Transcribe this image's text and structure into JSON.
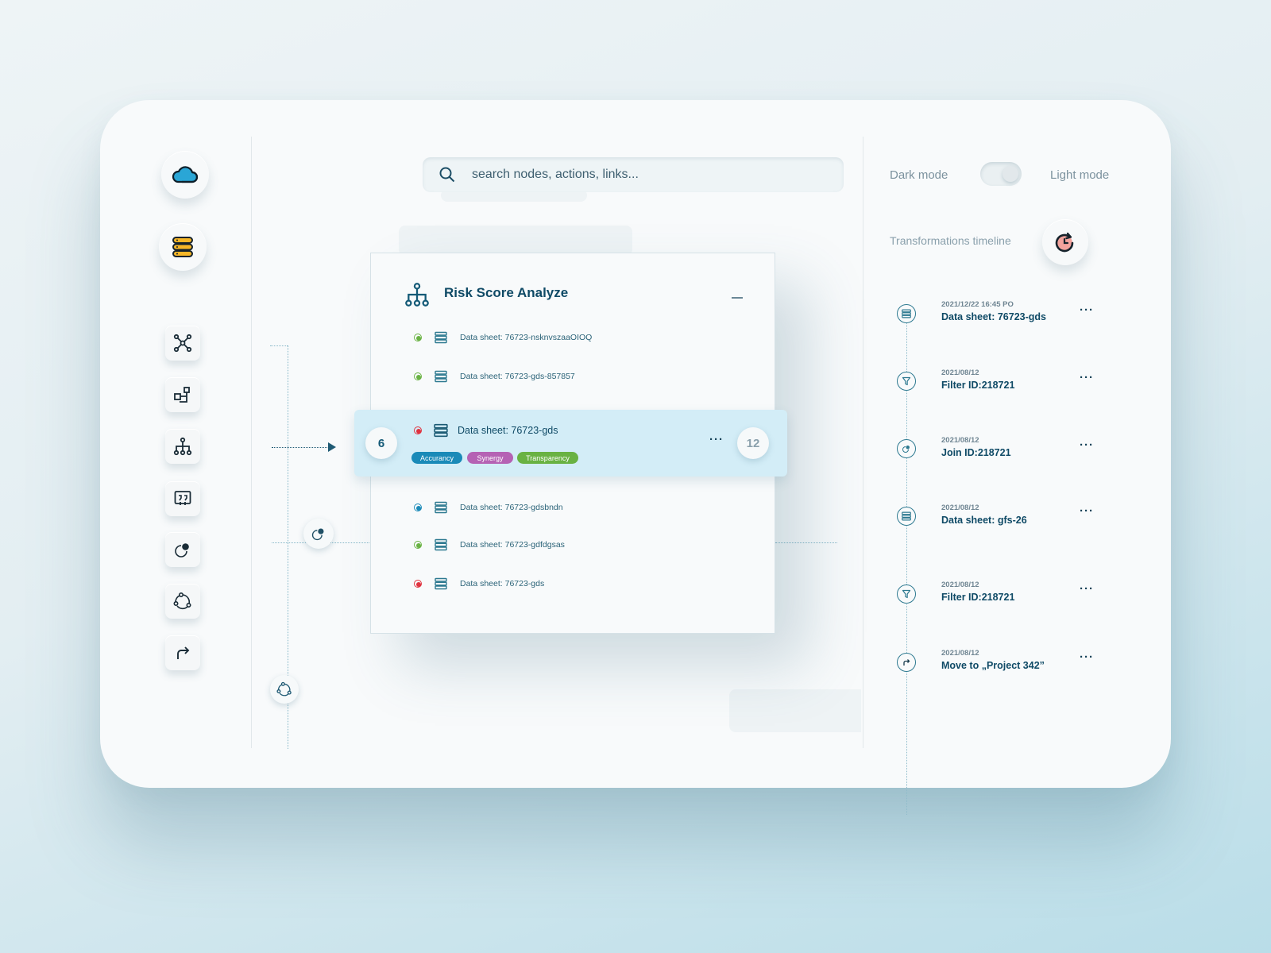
{
  "search": {
    "placeholder": "search nodes, actions, links..."
  },
  "sidebar": {
    "top_icons": [
      "cloud-icon",
      "database-stack-icon"
    ],
    "tools": [
      "network-icon",
      "shapes-icon",
      "hierarchy-icon",
      "quote-icon",
      "join-icon",
      "share-icon",
      "redirect-icon"
    ]
  },
  "panel": {
    "title": "Risk Score Analyze",
    "rows_top": [
      {
        "label": "Data sheet: 76723-nsknvszaaOIOQ",
        "status": "green"
      },
      {
        "label": "Data sheet: 76723-gds-857857",
        "status": "green"
      }
    ],
    "selected": {
      "label": "Data sheet: 76723-gds",
      "status": "red",
      "left_count": "6",
      "right_count": "12",
      "tags": [
        {
          "label": "Accurancy",
          "color": "#1a8ab8"
        },
        {
          "label": "Synergy",
          "color": "#b562b4"
        },
        {
          "label": "Transparency",
          "color": "#69b243"
        }
      ]
    },
    "rows_bottom": [
      {
        "label": "Data sheet: 76723-gdsbndn",
        "status": "blue"
      },
      {
        "label": "Data sheet: 76723-gdfdgsas",
        "status": "green"
      },
      {
        "label": "Data sheet: 76723-gds",
        "status": "red"
      }
    ]
  },
  "mode": {
    "dark_label": "Dark mode",
    "light_label": "Light mode",
    "current": "light"
  },
  "timeline": {
    "title": "Transformations timeline",
    "items": [
      {
        "date": "2021/12/22 16:45 PO",
        "name": "Data sheet: 76723-gds",
        "icon": "datasheet-icon"
      },
      {
        "date": "2021/08/12",
        "name": "Filter ID:218721",
        "icon": "filter-icon"
      },
      {
        "date": "2021/08/12",
        "name": "Join ID:218721",
        "icon": "join-icon"
      },
      {
        "date": "2021/08/12",
        "name": "Data sheet: gfs-26",
        "icon": "datasheet-icon"
      },
      {
        "date": "2021/08/12",
        "name": "Filter ID:218721",
        "icon": "filter-icon"
      },
      {
        "date": "2021/08/12",
        "name": "Move to „Project 342”",
        "icon": "redirect-icon"
      }
    ]
  },
  "colors": {
    "accent": "#0f4a66",
    "green": "#69b243",
    "red": "#e0313e",
    "blue": "#1a8ab8",
    "selected_bg": "#d3edf7"
  }
}
